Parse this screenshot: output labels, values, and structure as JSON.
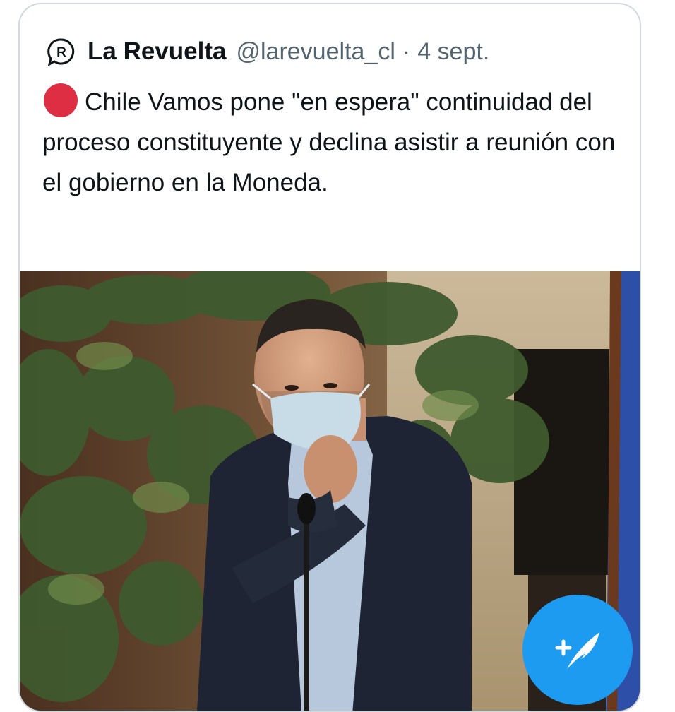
{
  "tweet": {
    "author_name": "La Revuelta",
    "handle": "@larevuelta_cl",
    "separator": "·",
    "date": "4 sept.",
    "text": "Chile Vamos pone \"en espera\" continuidad del proceso constituyente y declina asistir a reunión con el gobierno en la Moneda."
  },
  "icons": {
    "avatar": "revuelta-logo-icon",
    "emoji": "red-circle-icon",
    "compose": "compose-tweet-icon"
  },
  "colors": {
    "accent": "#1d9bf0",
    "red_circle": "#dd2e44",
    "text": "#0f1419",
    "muted": "#536471"
  }
}
